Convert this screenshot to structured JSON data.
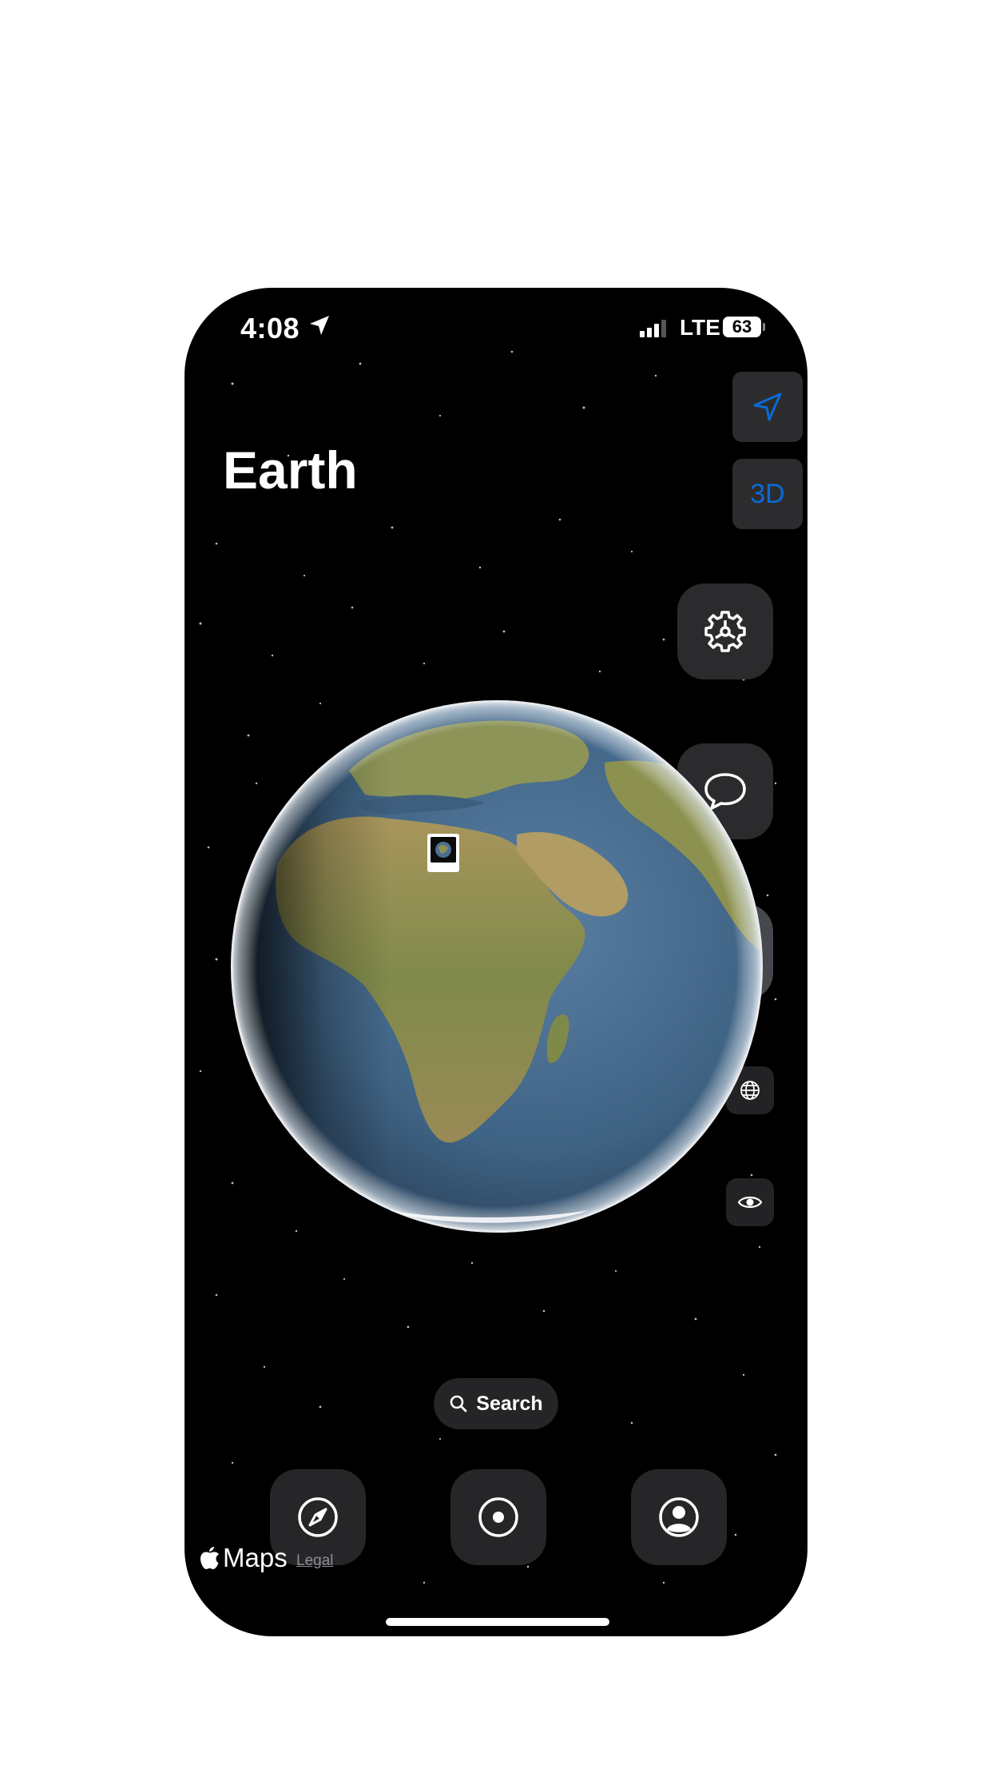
{
  "status_bar": {
    "time": "4:08",
    "network": "LTE",
    "battery": "63"
  },
  "title": "Earth",
  "controls": {
    "three_d_label": "3D"
  },
  "search": {
    "label": "Search"
  },
  "tabs": [
    {
      "icon": "compass-icon"
    },
    {
      "icon": "target-icon"
    },
    {
      "icon": "profile-icon"
    }
  ],
  "branding": {
    "maps_label": "Maps",
    "legal_label": "Legal"
  },
  "colors": {
    "accent_blue": "#0a6ad6",
    "background": "#000000"
  }
}
